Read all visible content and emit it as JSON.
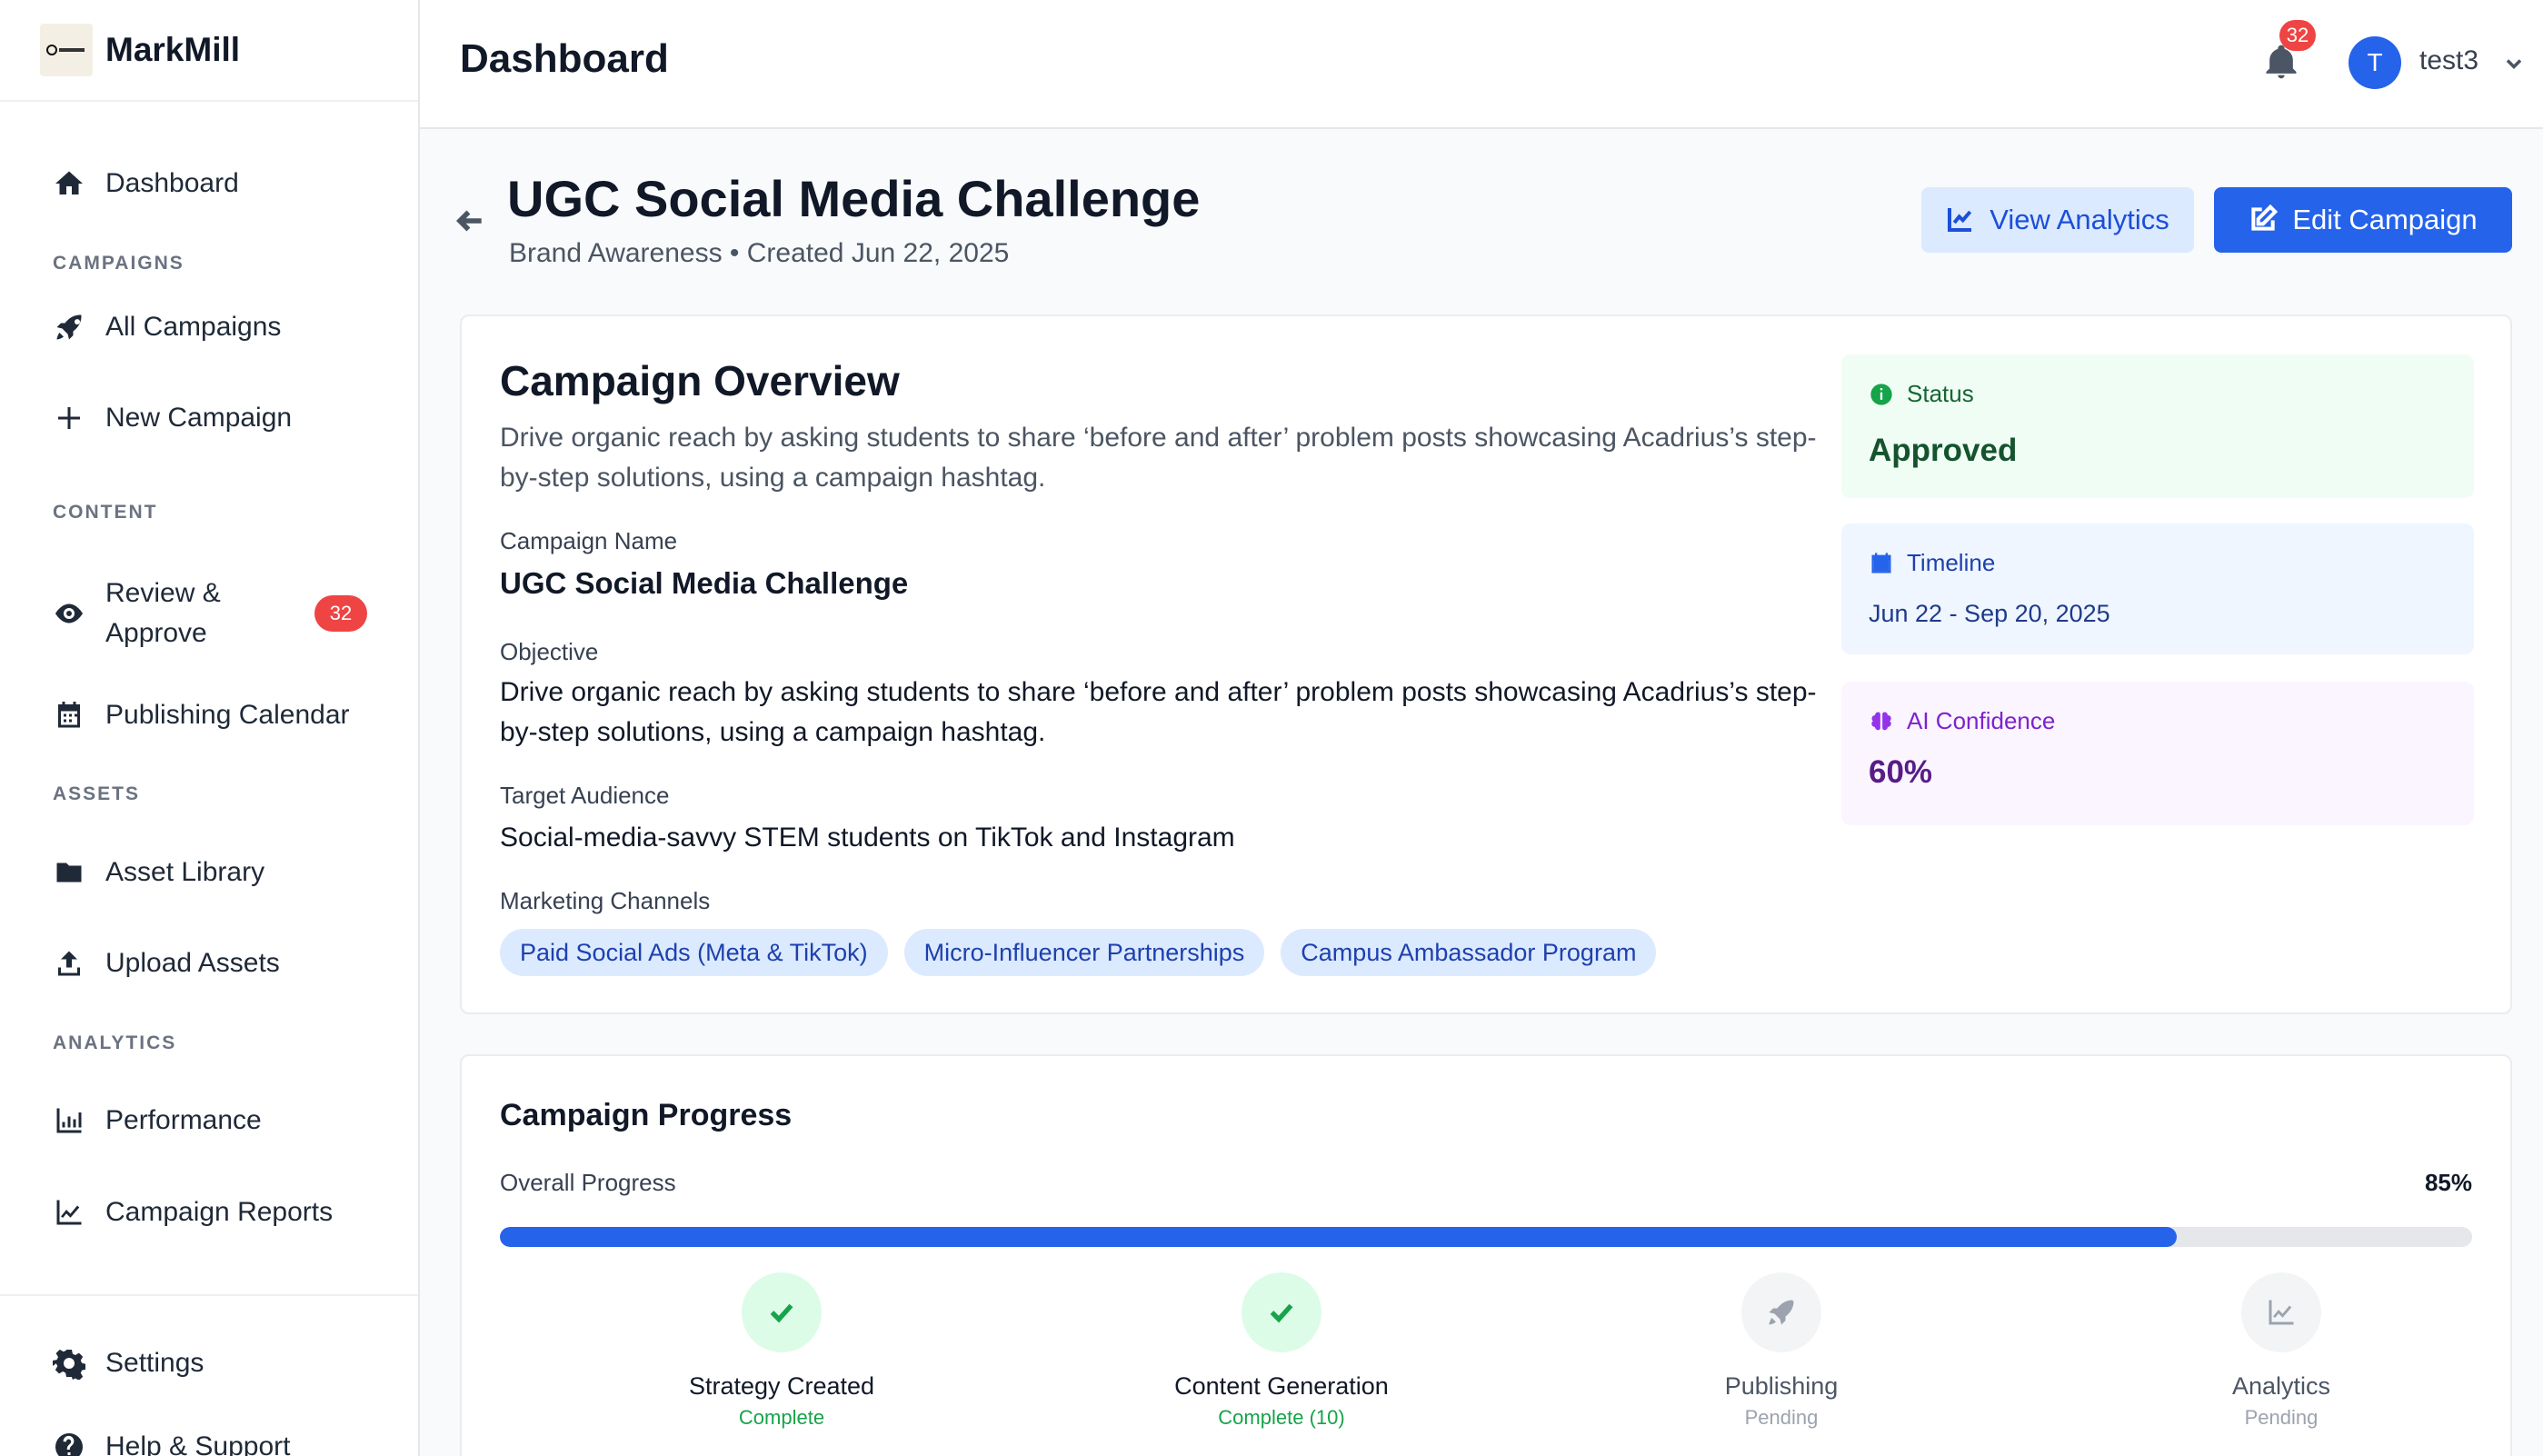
{
  "brand": {
    "name": "MarkMill"
  },
  "sidebar": {
    "dashboard": "Dashboard",
    "sections": {
      "campaigns": "CAMPAIGNS",
      "content": "CONTENT",
      "assets": "ASSETS",
      "analytics": "ANALYTICS"
    },
    "items": {
      "all_campaigns": "All Campaigns",
      "new_campaign": "New Campaign",
      "review_approve_line1": "Review &",
      "review_approve_line2": "Approve",
      "review_badge": "32",
      "publishing_calendar": "Publishing Calendar",
      "asset_library": "Asset Library",
      "upload_assets": "Upload Assets",
      "performance": "Performance",
      "campaign_reports": "Campaign Reports",
      "settings": "Settings",
      "help_support": "Help & Support"
    }
  },
  "header": {
    "title": "Dashboard",
    "notification_count": "32",
    "avatar_initial": "T",
    "username": "test3"
  },
  "campaign": {
    "title": "UGC Social Media Challenge",
    "meta": "Brand Awareness • Created Jun 22, 2025",
    "view_analytics_label": "View Analytics",
    "edit_campaign_label": "Edit Campaign"
  },
  "overview": {
    "title": "Campaign Overview",
    "description": "Drive organic reach by asking students to share ‘before and after’ problem posts showcasing Acadrius’s step-by-step solutions, using a campaign hashtag.",
    "name_label": "Campaign Name",
    "name_value": "UGC Social Media Challenge",
    "objective_label": "Objective",
    "objective_value": "Drive organic reach by asking students to share ‘before and after’ problem posts showcasing Acadrius’s step-by-step solutions, using a campaign hashtag.",
    "audience_label": "Target Audience",
    "audience_value": "Social-media-savvy STEM students on TikTok and Instagram",
    "channels_label": "Marketing Channels",
    "channels": [
      "Paid Social Ads (Meta & TikTok)",
      "Micro-Influencer Partnerships",
      "Campus Ambassador Program"
    ],
    "status_label": "Status",
    "status_value": "Approved",
    "timeline_label": "Timeline",
    "timeline_value": "Jun 22 - Sep 20, 2025",
    "ai_label": "AI Confidence",
    "ai_value": "60%"
  },
  "progress": {
    "title": "Campaign Progress",
    "overall_label": "Overall Progress",
    "overall_pct_text": "85%",
    "overall_value": 0.85,
    "steps": [
      {
        "name": "Strategy Created",
        "status": "Complete"
      },
      {
        "name": "Content Generation",
        "status": "Complete (10)"
      },
      {
        "name": "Publishing",
        "status": "Pending"
      },
      {
        "name": "Analytics",
        "status": "Pending"
      }
    ]
  },
  "colors": {
    "accent": "#2563eb",
    "badge": "#ef4444",
    "success": "#16a34a",
    "ai": "#7e22ce"
  }
}
